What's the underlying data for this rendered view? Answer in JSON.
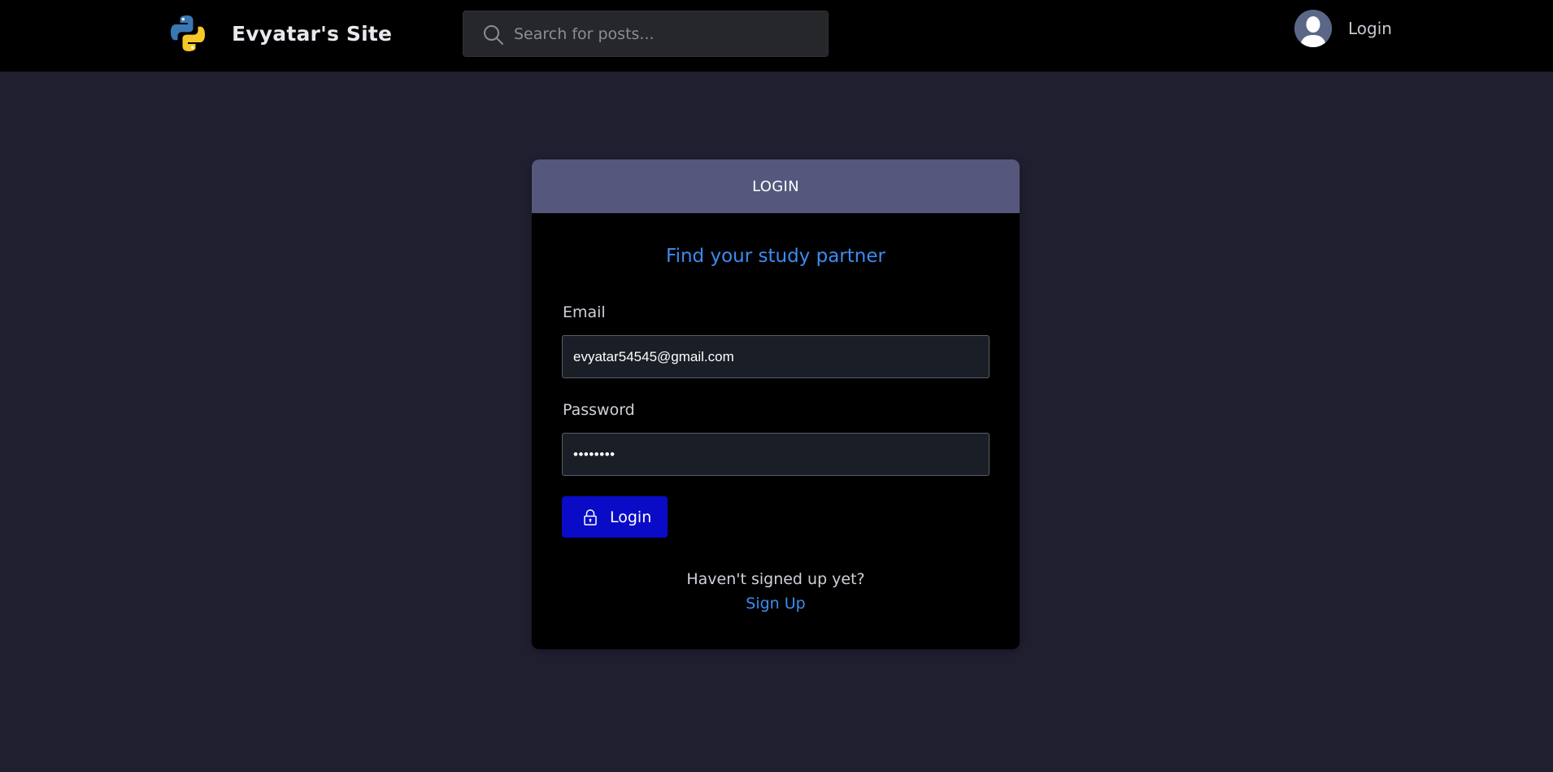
{
  "nav": {
    "brand_name": "Evyatar's Site",
    "brand_logo_icon": "python-logo-icon",
    "search": {
      "placeholder": "Search for posts...",
      "value": "",
      "icon": "search-icon"
    },
    "user": {
      "avatar_icon": "user-avatar-icon",
      "login_label": "Login"
    }
  },
  "card": {
    "header_title": "LOGIN",
    "tagline": "Find your study partner",
    "email": {
      "label": "Email",
      "value": "evyatar54545@gmail.com"
    },
    "password": {
      "label": "Password",
      "value": "••••••••"
    },
    "login_button": {
      "label": "Login",
      "icon": "lock-icon"
    },
    "signup_prompt": "Haven't signed up yet?",
    "signup_link": "Sign Up"
  },
  "colors": {
    "page_background": "#201f30",
    "navbar_background": "#000000",
    "card_header": "#55577c",
    "card_background": "#000000",
    "accent_blue": "#3c8cf1",
    "button_blue": "#0a0bc6",
    "input_background": "#1a1e26"
  }
}
